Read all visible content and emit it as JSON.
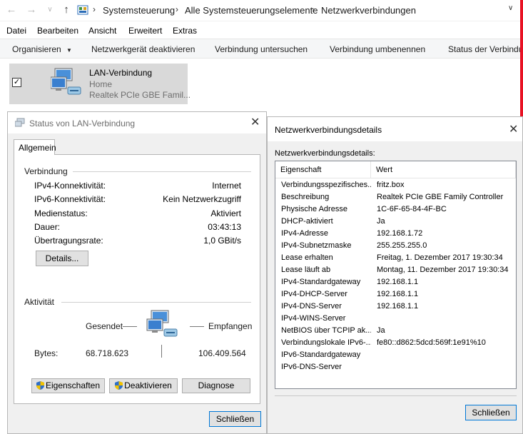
{
  "breadcrumb": [
    "Systemsteuerung",
    "Alle Systemsteuerungselemente",
    "Netzwerkverbindungen"
  ],
  "menu": [
    "Datei",
    "Bearbeiten",
    "Ansicht",
    "Erweitert",
    "Extras"
  ],
  "commands": {
    "organize": "Organisieren",
    "deactivate": "Netzwerkgerät deaktivieren",
    "diagnose": "Verbindung untersuchen",
    "rename": "Verbindung umbenennen",
    "status": "Status der Verbindung"
  },
  "connection": {
    "name": "LAN-Verbindung",
    "network": "Home",
    "adapter": "Realtek PCIe GBE Famil..."
  },
  "status_dialog": {
    "title": "Status von LAN-Verbindung",
    "tab": "Allgemein",
    "group_connection": "Verbindung",
    "fields": [
      {
        "label": "IPv4-Konnektivität:",
        "value": "Internet"
      },
      {
        "label": "IPv6-Konnektivität:",
        "value": "Kein Netzwerkzugriff"
      },
      {
        "label": "Medienstatus:",
        "value": "Aktiviert"
      },
      {
        "label": "Dauer:",
        "value": "03:43:13"
      },
      {
        "label": "Übertragungsrate:",
        "value": "1,0 GBit/s"
      }
    ],
    "details_button": "Details...",
    "group_activity": "Aktivität",
    "sent_label": "Gesendet",
    "received_label": "Empfangen",
    "bytes_label": "Bytes:",
    "bytes_sent": "68.718.623",
    "bytes_received": "106.409.564",
    "properties_button": "Eigenschaften",
    "deactivate_button": "Deaktivieren",
    "diagnose_button": "Diagnose",
    "close_button": "Schließen"
  },
  "details_dialog": {
    "title": "Netzwerkverbindungsdetails",
    "label": "Netzwerkverbindungsdetails:",
    "col_property": "Eigenschaft",
    "col_value": "Wert",
    "rows": [
      {
        "p": "Verbindungsspezifisches...",
        "v": "fritz.box"
      },
      {
        "p": "Beschreibung",
        "v": "Realtek PCIe GBE Family Controller"
      },
      {
        "p": "Physische Adresse",
        "v": "1C-6F-65-84-4F-BC"
      },
      {
        "p": "DHCP-aktiviert",
        "v": "Ja"
      },
      {
        "p": "IPv4-Adresse",
        "v": "192.168.1.72"
      },
      {
        "p": "IPv4-Subnetzmaske",
        "v": "255.255.255.0"
      },
      {
        "p": "Lease erhalten",
        "v": "Freitag, 1. Dezember 2017 19:30:34"
      },
      {
        "p": "Lease läuft ab",
        "v": "Montag, 11. Dezember 2017 19:30:34"
      },
      {
        "p": "IPv4-Standardgateway",
        "v": "192.168.1.1"
      },
      {
        "p": "IPv4-DHCP-Server",
        "v": "192.168.1.1"
      },
      {
        "p": "IPv4-DNS-Server",
        "v": "192.168.1.1"
      },
      {
        "p": "IPv4-WINS-Server",
        "v": ""
      },
      {
        "p": "NetBIOS über TCPIP ak...",
        "v": "Ja"
      },
      {
        "p": "Verbindungslokale IPv6-...",
        "v": "fe80::d862:5dcd:569f:1e91%10"
      },
      {
        "p": "IPv6-Standardgateway",
        "v": ""
      },
      {
        "p": "IPv6-DNS-Server",
        "v": ""
      }
    ],
    "close_button": "Schließen"
  }
}
